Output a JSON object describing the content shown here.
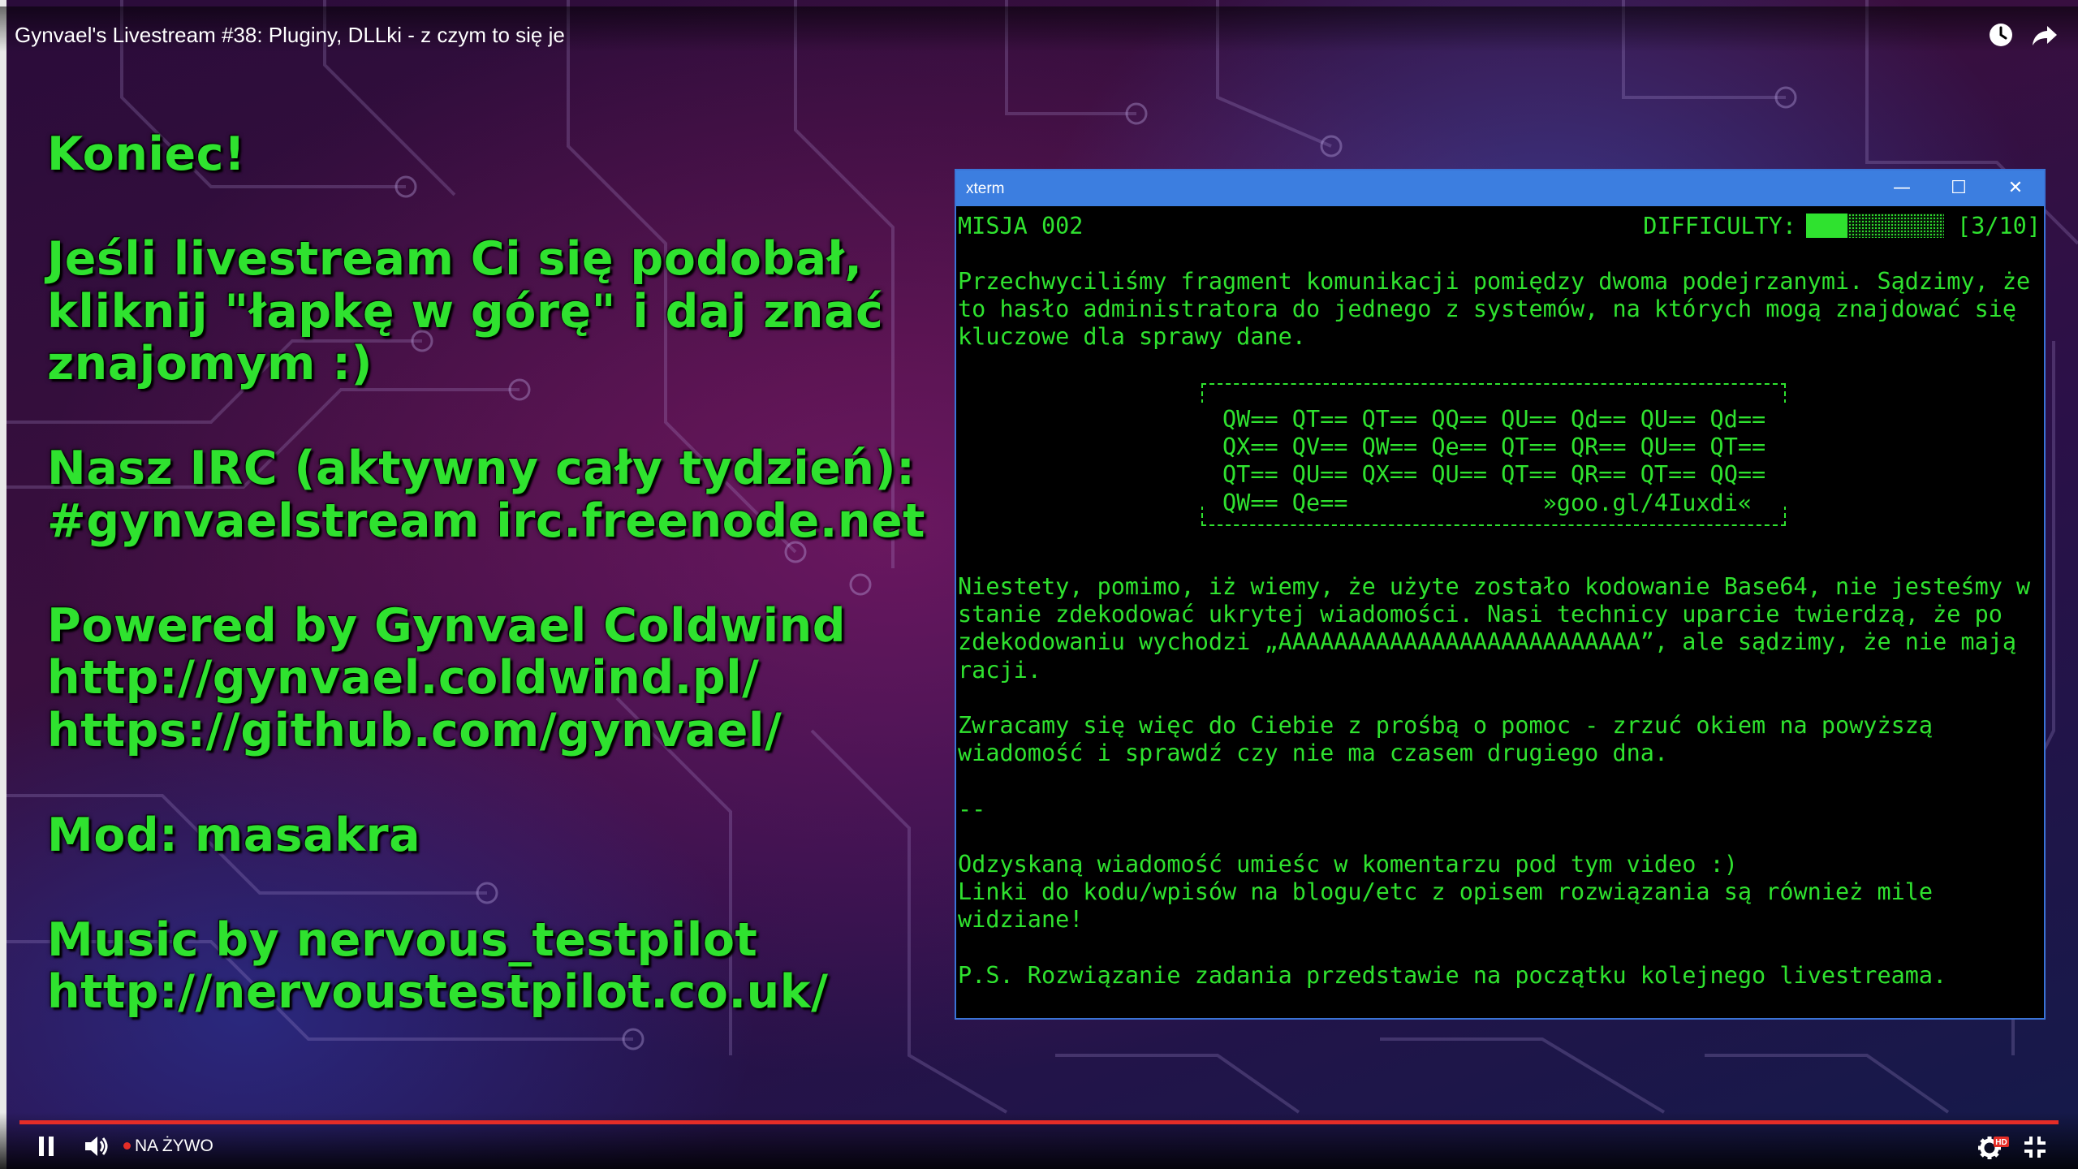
{
  "video": {
    "title": "Gynvael's Livestream #38: Pluginy, DLLki - z czym to się je"
  },
  "overlay_text": [
    "Koniec!",
    "",
    "Jeśli livestream Ci się podobał,",
    "kliknij \"łapkę w górę\" i daj znać",
    "znajomym :)",
    "",
    "Nasz IRC (aktywny cały tydzień):",
    "#gynvaelstream irc.freenode.net",
    "",
    "Powered by Gynvael Coldwind",
    "http://gynvael.coldwind.pl/",
    "https://github.com/gynvael/",
    "",
    "Mod: masakra",
    "",
    "Music by nervous_testpilot",
    "http://nervoustestpilot.co.uk/"
  ],
  "xterm": {
    "window_title": "xterm",
    "minimize": "—",
    "maximize": "☐",
    "close": "✕",
    "mission": "MISJA 002",
    "difficulty_label": "DIFFICULTY:",
    "difficulty_value": "[3/10]",
    "difficulty_level": 0.3,
    "intro": [
      "Przechwyciliśmy fragment komunikacji pomiędzy dwoma podejrzanymi. Sądzimy, że",
      "to hasło administratora do jednego z systemów, na których mogą znajdować się",
      "kluczowe dla sprawy dane."
    ],
    "code_lines": [
      "QW== QT== QT== QQ== QU== Qd== QU== Qd==",
      "QX== QV== QW== Qe== QT== QR== QU== QT==",
      "QT== QU== QX== QU== QT== QR== QT== QQ==",
      "QW== Qe==              »goo.gl/4Iuxdi«"
    ],
    "body": [
      "Niestety, pomimo, iż wiemy, że użyte zostało kodowanie Base64, nie jesteśmy w",
      "stanie zdekodować ukrytej wiadomości. Nasi technicy uparcie twierdzą, że po",
      "zdekodowaniu wychodzi „AAAAAAAAAAAAAAAAAAAAAAAAAA”, ale sądzimy, że nie mają",
      "racji.",
      "",
      "Zwracamy się więc do Ciebie z prośbą o pomoc - zrzuć okiem na powyższą",
      "wiadomość i sprawdź czy nie ma czasem drugiego dna.",
      "",
      "--",
      "",
      "Odzyskaną wiadomość umieśc w komentarzu pod tym video :)",
      "Linki do kodu/wpisów na blogu/etc z opisem rozwiązania są również mile",
      "widziane!",
      "",
      "P.S. Rozwiązanie zadania przedstawie na początku kolejnego livestreama."
    ]
  },
  "player": {
    "live_label": "NA ŻYWO",
    "hd_badge": "HD",
    "accent_color": "#e52d27",
    "text_color": "#2fe22f"
  },
  "icons": {
    "watch_later": "clock-icon",
    "share": "share-icon",
    "pause": "pause-icon",
    "volume": "volume-icon",
    "settings": "gear-icon",
    "exit_fullscreen": "exit-fullscreen-icon"
  }
}
